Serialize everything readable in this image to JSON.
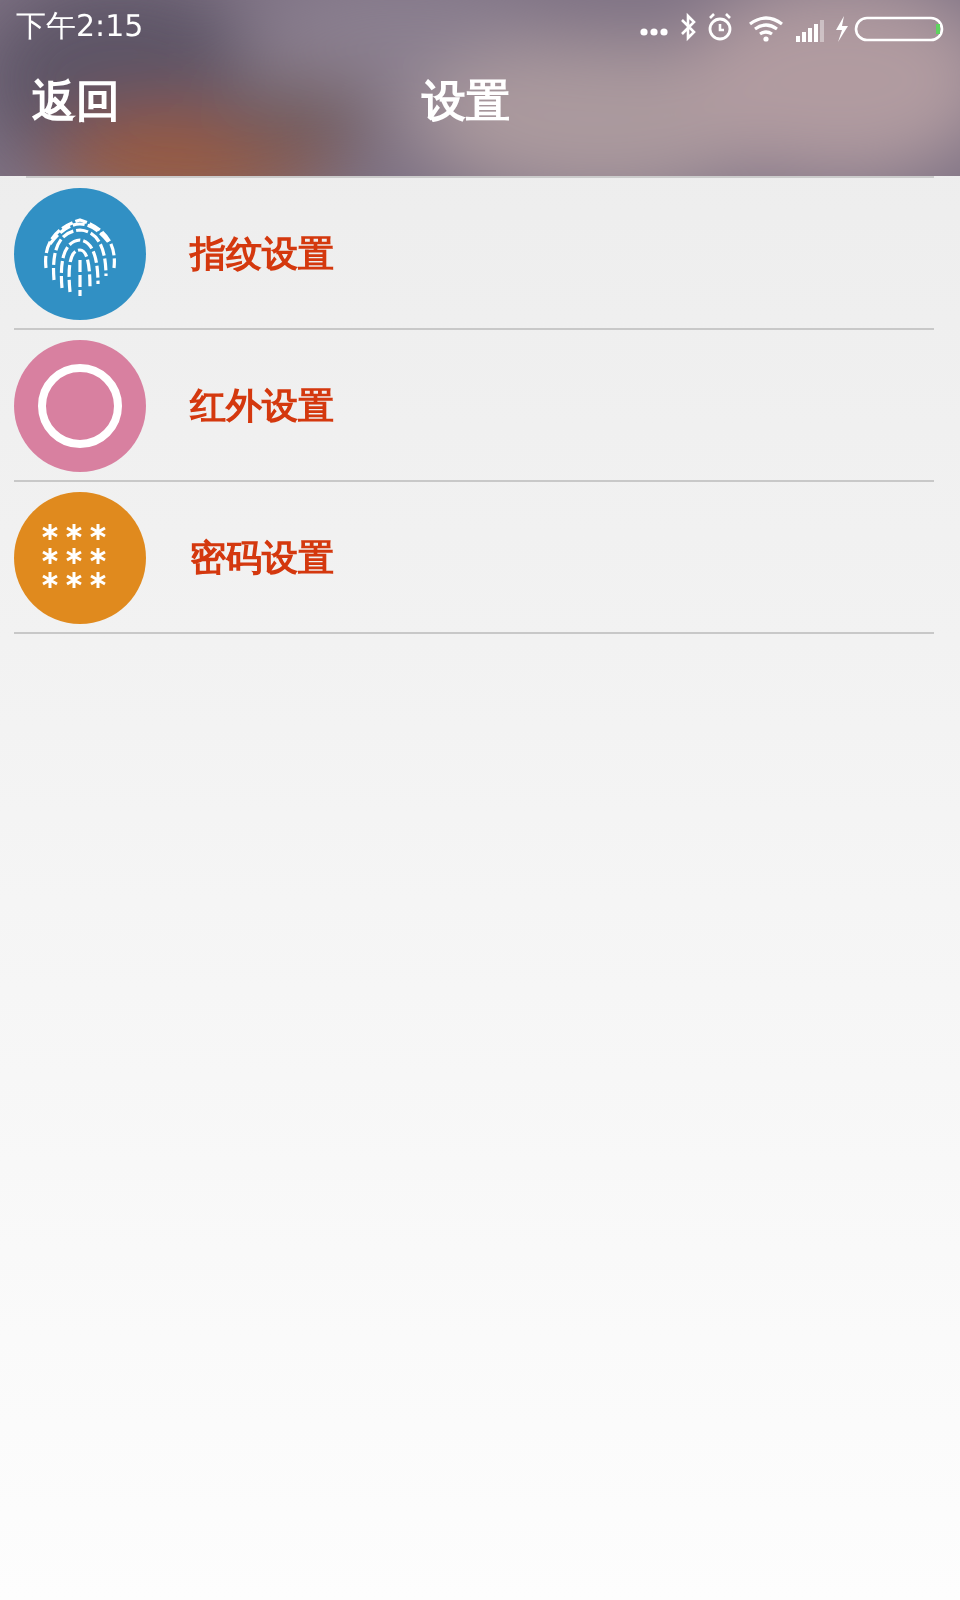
{
  "status_bar": {
    "time": "下午2:15"
  },
  "header": {
    "back": "返回",
    "title": "设置"
  },
  "items": [
    {
      "kind": "fingerprint",
      "label": "指纹设置",
      "color": "#3190c4"
    },
    {
      "kind": "ring",
      "label": "红外设置",
      "color": "#d880a0"
    },
    {
      "kind": "password",
      "label": "密码设置",
      "color": "#e08a1e"
    }
  ]
}
